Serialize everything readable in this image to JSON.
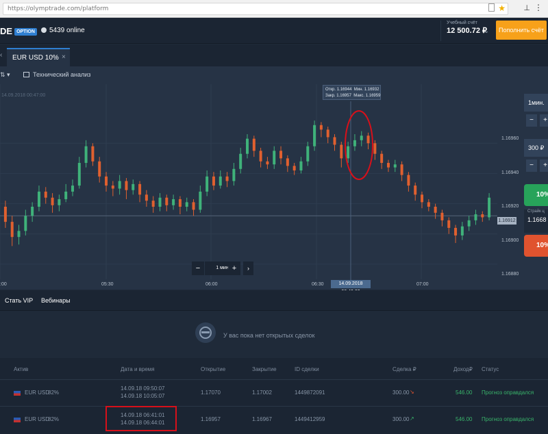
{
  "browser": {
    "url": "https://olymptrade.com/platform",
    "url_host": "https://olymptrade.com/",
    "url_path": "platform"
  },
  "header": {
    "logo_text": "DE",
    "logo_badge": "OPTION",
    "online_count": "5439 online",
    "account_label": "Учебный счёт",
    "account_balance": "12 500.72 ₽",
    "topup_label": "Пополнить счёт"
  },
  "tabs": [
    {
      "label": "EUR USD  10%"
    }
  ],
  "toolbar": {
    "analysis_label": "Технический анализ"
  },
  "chart": {
    "date_mark": "14.09.2018 00:47:00",
    "tooltip": {
      "open": "Откр. 1.16944",
      "low": "Мин. 1.16932",
      "close": "Закр. 1.16957",
      "high": "Макс. 1.16959"
    },
    "y_ticks": [
      "1.16960",
      "1.16940",
      "1.16920",
      "1.16900",
      "1.16880"
    ],
    "current_price": "1.16912",
    "x_ticks": [
      ":00",
      "05:30",
      "06:00",
      "06:30",
      "07:00"
    ],
    "x_highlight": "14.09.2018 06:40:00",
    "zoom_label": "1 мин"
  },
  "chart_data": {
    "type": "candlestick",
    "ylim": [
      1.1687,
      1.1699
    ],
    "current_price": 1.16912,
    "candles": [
      [
        1.16918,
        1.16908,
        1.16922,
        1.16904
      ],
      [
        1.16908,
        1.16898,
        1.16912,
        1.16892
      ],
      [
        1.16898,
        1.16902,
        1.16906,
        1.16893
      ],
      [
        1.16902,
        1.16912,
        1.16916,
        1.16899
      ],
      [
        1.16912,
        1.16918,
        1.16921,
        1.16908
      ],
      [
        1.16918,
        1.16928,
        1.16932,
        1.16915
      ],
      [
        1.16928,
        1.16924,
        1.16931,
        1.1692
      ],
      [
        1.16924,
        1.16919,
        1.16927,
        1.16914
      ],
      [
        1.16919,
        1.16923,
        1.16926,
        1.16915
      ],
      [
        1.16923,
        1.16928,
        1.16933,
        1.16921
      ],
      [
        1.16928,
        1.16932,
        1.16936,
        1.16925
      ],
      [
        1.16932,
        1.16947,
        1.16951,
        1.1693
      ],
      [
        1.16947,
        1.16958,
        1.16962,
        1.16944
      ],
      [
        1.16958,
        1.16948,
        1.1696,
        1.16945
      ],
      [
        1.16948,
        1.16938,
        1.16951,
        1.16934
      ],
      [
        1.16938,
        1.16932,
        1.16941,
        1.16928
      ],
      [
        1.16932,
        1.1693,
        1.16935,
        1.16925
      ],
      [
        1.1693,
        1.16935,
        1.16939,
        1.16926
      ],
      [
        1.16935,
        1.16929,
        1.16937,
        1.16923
      ],
      [
        1.16929,
        1.16933,
        1.16936,
        1.16926
      ],
      [
        1.16933,
        1.16926,
        1.16935,
        1.16921
      ],
      [
        1.16926,
        1.16922,
        1.16929,
        1.16918
      ],
      [
        1.16922,
        1.16918,
        1.16925,
        1.16914
      ],
      [
        1.16918,
        1.16924,
        1.16927,
        1.16915
      ],
      [
        1.16924,
        1.16919,
        1.16926,
        1.16915
      ],
      [
        1.16919,
        1.16923,
        1.16926,
        1.16916
      ],
      [
        1.16923,
        1.16918,
        1.16925,
        1.16913
      ],
      [
        1.16918,
        1.16921,
        1.16924,
        1.16915
      ],
      [
        1.16921,
        1.16916,
        1.16923,
        1.16912
      ],
      [
        1.16916,
        1.16928,
        1.16932,
        1.16914
      ],
      [
        1.16928,
        1.16938,
        1.16942,
        1.16925
      ],
      [
        1.16938,
        1.16932,
        1.16941,
        1.16929
      ],
      [
        1.16932,
        1.16938,
        1.16942,
        1.1693
      ],
      [
        1.16938,
        1.16935,
        1.16941,
        1.16931
      ],
      [
        1.16935,
        1.16943,
        1.16947,
        1.16932
      ],
      [
        1.16943,
        1.16953,
        1.16957,
        1.1694
      ],
      [
        1.16953,
        1.16963,
        1.16966,
        1.1695
      ],
      [
        1.16963,
        1.16955,
        1.16965,
        1.16951
      ],
      [
        1.16955,
        1.16948,
        1.16957,
        1.16944
      ],
      [
        1.16948,
        1.16946,
        1.16951,
        1.16943
      ],
      [
        1.16946,
        1.16955,
        1.16958,
        1.16943
      ],
      [
        1.16955,
        1.1695,
        1.16958,
        1.16946
      ],
      [
        1.1695,
        1.16945,
        1.16952,
        1.16941
      ],
      [
        1.16945,
        1.16942,
        1.16947,
        1.16939
      ],
      [
        1.16942,
        1.16948,
        1.16951,
        1.1694
      ],
      [
        1.16948,
        1.16958,
        1.16961,
        1.16945
      ],
      [
        1.16958,
        1.16972,
        1.16975,
        1.16955
      ],
      [
        1.16972,
        1.16969,
        1.16974,
        1.16964
      ],
      [
        1.16969,
        1.16964,
        1.16971,
        1.1696
      ],
      [
        1.16964,
        1.16959,
        1.16966,
        1.16955
      ],
      [
        1.16959,
        1.1695,
        1.16961,
        1.16944
      ],
      [
        1.1695,
        1.16958,
        1.16961,
        1.16947
      ],
      [
        1.16958,
        1.16962,
        1.16966,
        1.16955
      ],
      [
        1.16962,
        1.16965,
        1.16968,
        1.16958
      ],
      [
        1.16965,
        1.1696,
        1.16967,
        1.16956
      ],
      [
        1.1696,
        1.16953,
        1.16962,
        1.16949
      ],
      [
        1.16953,
        1.16947,
        1.16955,
        1.16943
      ],
      [
        1.16947,
        1.16944,
        1.16949,
        1.16941
      ],
      [
        1.16944,
        1.16946,
        1.16949,
        1.16941
      ],
      [
        1.16946,
        1.16939,
        1.16948,
        1.16935
      ],
      [
        1.16939,
        1.16932,
        1.16941,
        1.16928
      ],
      [
        1.16932,
        1.16926,
        1.16934,
        1.16922
      ],
      [
        1.16926,
        1.16921,
        1.16928,
        1.16917
      ],
      [
        1.16921,
        1.16918,
        1.16923,
        1.16915
      ],
      [
        1.16918,
        1.16914,
        1.1692,
        1.1691
      ],
      [
        1.16914,
        1.16909,
        1.16916,
        1.16905
      ],
      [
        1.16909,
        1.16904,
        1.16911,
        1.169
      ],
      [
        1.16904,
        1.16899,
        1.16906,
        1.16894
      ],
      [
        1.16899,
        1.16905,
        1.16908,
        1.16896
      ],
      [
        1.16905,
        1.16909,
        1.16912,
        1.16902
      ],
      [
        1.16909,
        1.16913,
        1.16916,
        1.16906
      ],
      [
        1.16913,
        1.16911,
        1.16915,
        1.16908
      ],
      [
        1.16911,
        1.16924,
        1.16927,
        1.16909
      ]
    ]
  },
  "side_panel": {
    "timeframe": "1мин.",
    "amount": "300 ₽",
    "up_label": "10%",
    "strike_label": "Страйк ц",
    "strike_value": "1.1668",
    "down_label": "10%"
  },
  "bottom_tabs": [
    "Стать VIP",
    "Вебинары"
  ],
  "empty_state": "У вас пока нет открытых сделок",
  "table": {
    "headers": [
      "Актив",
      "Дата и время",
      "Открытие",
      "Закрытие",
      "ID сделки",
      "Сделка ₽",
      "Доход₽",
      "Статус"
    ],
    "rows": [
      {
        "asset": "EUR USD",
        "pct": "82%",
        "dt1": "14.09.18 09:50:07",
        "dt2": "14.09.18 10:05:07",
        "open": "1.17070",
        "close": "1.17002",
        "id": "1449872091",
        "deal": "300.00",
        "income": "546.00",
        "status": "Прогноз оправдался"
      },
      {
        "asset": "EUR USD",
        "pct": "82%",
        "dt1": "14.09.18 06:41:01",
        "dt2": "14.09.18 06:44:01",
        "open": "1.16957",
        "close": "1.16967",
        "id": "1449412959",
        "deal": "300.00",
        "income": "546.00",
        "status": "Прогноз оправдался"
      }
    ]
  }
}
